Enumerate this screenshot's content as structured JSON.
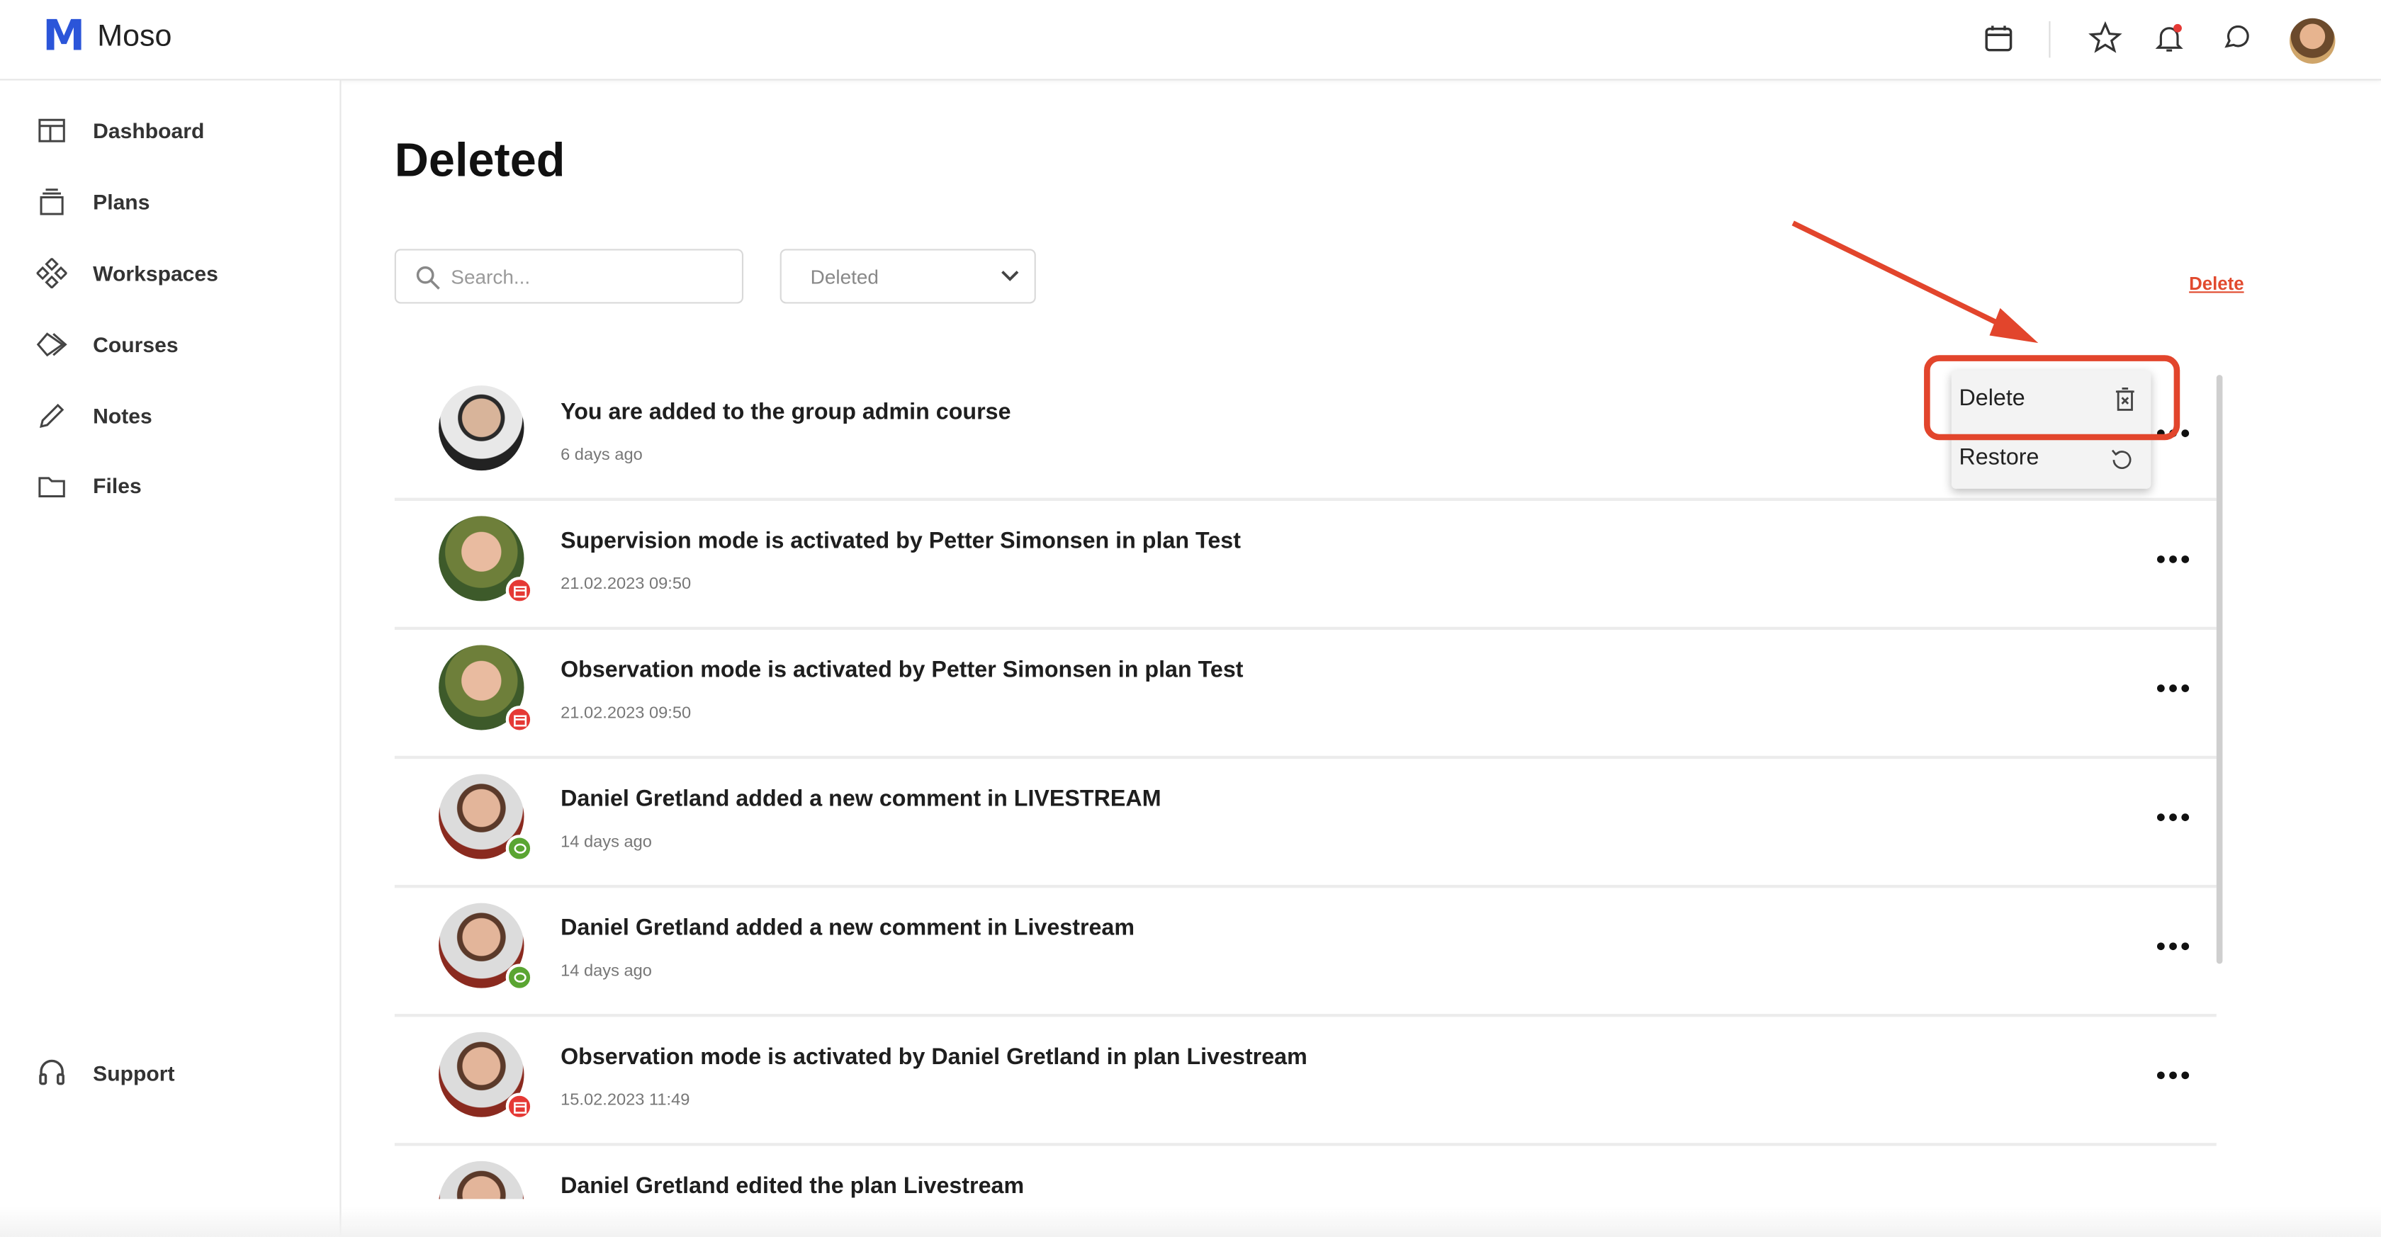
{
  "app": {
    "logo_mark": "M",
    "logo_text": "Moso"
  },
  "header": {
    "icons": [
      "calendar-icon",
      "star-icon",
      "bell-icon",
      "chat-icon",
      "user-avatar"
    ]
  },
  "sidebar": {
    "items": [
      {
        "label": "Dashboard",
        "icon": "dashboard-icon"
      },
      {
        "label": "Plans",
        "icon": "plans-icon"
      },
      {
        "label": "Workspaces",
        "icon": "workspaces-icon"
      },
      {
        "label": "Courses",
        "icon": "courses-icon"
      },
      {
        "label": "Notes",
        "icon": "pencil-icon"
      },
      {
        "label": "Files",
        "icon": "folder-icon"
      }
    ],
    "support_label": "Support"
  },
  "main": {
    "title": "Deleted",
    "search_placeholder": "Search...",
    "filter_value": "Deleted",
    "delete_link": "Delete"
  },
  "menu": {
    "delete_label": "Delete",
    "restore_label": "Restore"
  },
  "notifications": [
    {
      "title": "You are added to the group admin course",
      "time": "6 days ago",
      "badge": "none"
    },
    {
      "title": "Supervision mode is activated by Petter Simonsen in plan Test",
      "time": "21.02.2023 09:50",
      "badge": "calendar"
    },
    {
      "title": "Observation mode is activated by Petter Simonsen in plan Test",
      "time": "21.02.2023 09:50",
      "badge": "calendar"
    },
    {
      "title": "Daniel Gretland added a new comment in LIVESTREAM",
      "time": "14 days ago",
      "badge": "comment"
    },
    {
      "title": "Daniel Gretland added a new comment in Livestream",
      "time": "14 days ago",
      "badge": "comment"
    },
    {
      "title": "Observation mode is activated by Daniel Gretland in plan Livestream",
      "time": "15.02.2023 11:49",
      "badge": "calendar"
    },
    {
      "title": "Daniel Gretland edited the plan Livestream",
      "time": "",
      "badge": "none"
    }
  ],
  "colors": {
    "brand": "#2b55d9",
    "accent_red": "#e2452c",
    "badge_calendar": "#e53935",
    "badge_comment": "#5aa532"
  }
}
